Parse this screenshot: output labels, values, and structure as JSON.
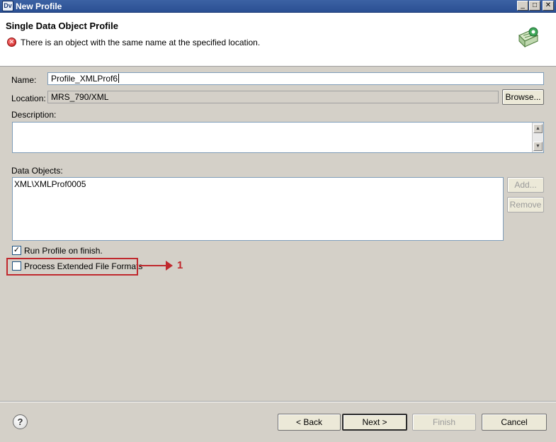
{
  "window": {
    "app_icon_text": "Dv",
    "title": "New Profile",
    "controls": {
      "minimize": "_",
      "maximize": "□",
      "close": "✕"
    }
  },
  "header": {
    "title": "Single Data Object Profile",
    "error_message": "There is an object with the same name at the specified location.",
    "banner_icon": "profile-wizard-icon"
  },
  "form": {
    "name_label": "Name:",
    "name_value": "Profile_XMLProf6",
    "location_label": "Location:",
    "location_value": "MRS_790/XML",
    "browse_label": "Browse...",
    "description_label": "Description:",
    "description_value": "",
    "data_objects_label": "Data Objects:",
    "data_objects": [
      "XML\\XMLProf0005"
    ],
    "add_label": "Add...",
    "remove_label": "Remove",
    "run_profile_label": "Run Profile on finish.",
    "run_profile_checked": true,
    "process_extended_label": "Process Extended File Formats",
    "process_extended_checked": false
  },
  "annotation": {
    "number": "1",
    "color": "#c0282d"
  },
  "footer": {
    "back_label": "< Back",
    "next_label": "Next >",
    "finish_label": "Finish",
    "cancel_label": "Cancel"
  },
  "colors": {
    "titlebar": "#2a4f93",
    "dialog_bg": "#d4d0c8",
    "error": "#c41818"
  }
}
